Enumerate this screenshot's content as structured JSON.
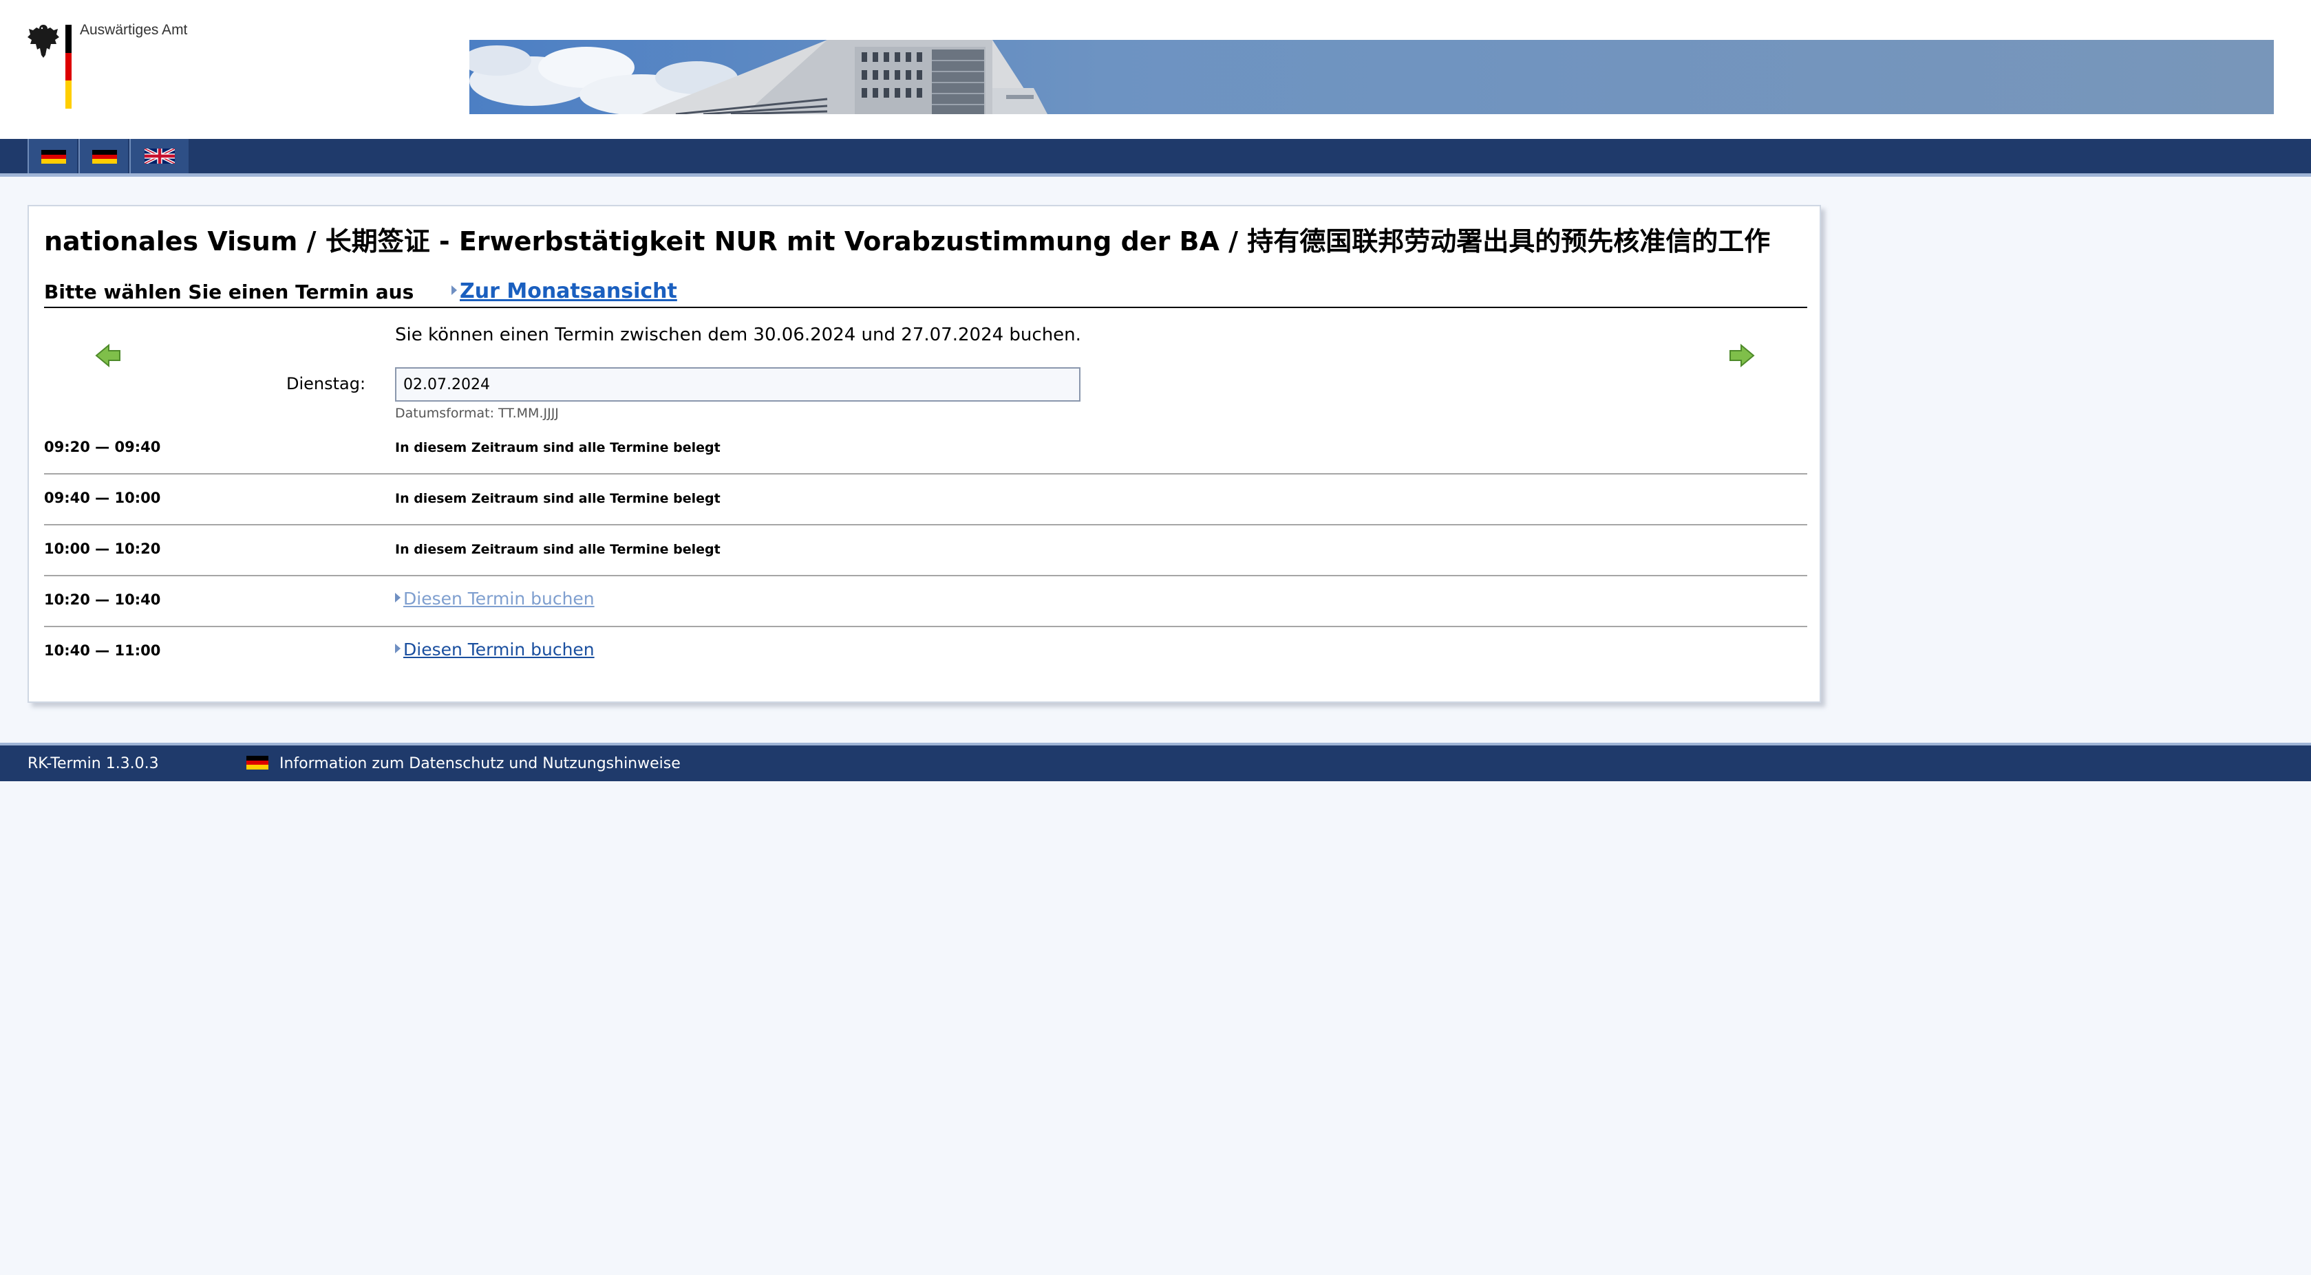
{
  "header": {
    "org_name": "Auswärtiges Amt",
    "languages": [
      {
        "flag": "de-flag-icon"
      },
      {
        "flag": "de-flag-icon"
      },
      {
        "flag": "uk-flag-icon"
      }
    ]
  },
  "main": {
    "title": "nationales Visum / 长期签证 - Erwerbstätigkeit NUR mit Vorabzustimmung der BA / 持有德国联邦劳动署出具的预先核准信的工作",
    "subheading": "Bitte wählen Sie einen Termin aus",
    "month_view_link": "Zur Monatsansicht",
    "range_info": "Sie können einen Termin zwischen dem 30.06.2024 und 27.07.2024 buchen.",
    "day_label": "Dienstag:",
    "date_value": "02.07.2024",
    "date_format_hint": "Datumsformat: TT.MM.JJJJ",
    "slots": [
      {
        "time": "09:20 — 09:40",
        "status": "In diesem Zeitraum sind alle Termine belegt"
      },
      {
        "time": "09:40 — 10:00",
        "status": "In diesem Zeitraum sind alle Termine belegt"
      },
      {
        "time": "10:00 — 10:20",
        "status": "In diesem Zeitraum sind alle Termine belegt"
      },
      {
        "time": "10:20 — 10:40",
        "link": "Diesen Termin buchen"
      },
      {
        "time": "10:40 — 11:00",
        "link": "Diesen Termin buchen"
      }
    ]
  },
  "footer": {
    "version": "RK-Termin 1.3.0.3",
    "privacy_link": "Information zum Datenschutz und Nutzungshinweise"
  },
  "colors": {
    "nav_bg": "#1f3a6b",
    "link": "#1a5fbf",
    "visited_link": "#7f9fcf",
    "arrow_green": "#6fae3a"
  }
}
